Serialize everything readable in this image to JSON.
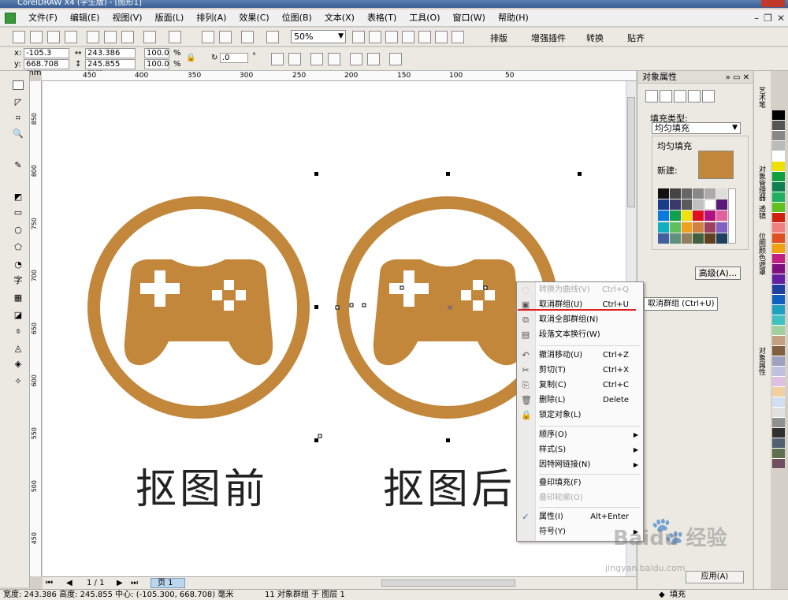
{
  "window": {
    "title": "CorelDRAW X4 (学生版) - [图形1]"
  },
  "menubar": {
    "items": [
      "文件(F)",
      "编辑(E)",
      "视图(V)",
      "版面(L)",
      "排列(A)",
      "效果(C)",
      "位图(B)",
      "文本(X)",
      "表格(T)",
      "工具(O)",
      "窗口(W)",
      "帮助(H)"
    ]
  },
  "toolbar": {
    "zoom": "50%",
    "buttons": [
      "排版",
      "增强插件",
      "转换",
      "贴齐"
    ]
  },
  "property_bar": {
    "x": "-105.3 mm",
    "y": "668.708 mm",
    "width": "243.386 mm",
    "height": "245.855 mm",
    "scale_x": "100.0",
    "scale_y": "100.0",
    "percent": "%",
    "rotation": ".0",
    "degree": "°"
  },
  "ruler": {
    "h_labels": [
      "450",
      "400",
      "350",
      "300",
      "250",
      "200",
      "150",
      "100",
      "50"
    ],
    "v_labels": [
      "850",
      "800",
      "750",
      "700",
      "650",
      "600",
      "550",
      "500",
      "450"
    ]
  },
  "canvas": {
    "fill_color": "#c2873a",
    "caption_left": "抠图前",
    "caption_right": "抠图后"
  },
  "context_menu": {
    "items": [
      {
        "label": "转换为曲线(V)",
        "shortcut": "Ctrl+Q",
        "disabled": true
      },
      {
        "label": "取消群组(U)",
        "shortcut": "Ctrl+U",
        "disabled": false
      },
      {
        "label": "取消全部群组(N)",
        "shortcut": "",
        "disabled": false
      },
      {
        "label": "段落文本换行(W)",
        "shortcut": "",
        "disabled": false
      },
      {
        "label": "撤消移动(U)",
        "shortcut": "Ctrl+Z",
        "disabled": false
      },
      {
        "label": "剪切(T)",
        "shortcut": "Ctrl+X",
        "disabled": false
      },
      {
        "label": "复制(C)",
        "shortcut": "Ctrl+C",
        "disabled": false
      },
      {
        "label": "删除(L)",
        "shortcut": "Delete",
        "disabled": false
      },
      {
        "label": "锁定对象(L)",
        "shortcut": "",
        "disabled": false
      },
      {
        "label": "顺序(O)",
        "shortcut": "",
        "disabled": false
      },
      {
        "label": "样式(S)",
        "shortcut": "",
        "disabled": false
      },
      {
        "label": "因特网链接(N)",
        "shortcut": "",
        "disabled": false
      },
      {
        "label": "叠印填充(F)",
        "shortcut": "",
        "disabled": false
      },
      {
        "label": "叠印轮廓(O)",
        "shortcut": "",
        "disabled": true
      },
      {
        "label": "属性(I)",
        "shortcut": "Alt+Enter",
        "disabled": false
      },
      {
        "label": "符号(Y)",
        "shortcut": "",
        "disabled": false
      }
    ],
    "tooltip": "取消群组 (Ctrl+U)"
  },
  "docker": {
    "title": "对象属性",
    "fill_type_label": "填充类型:",
    "fill_type_value": "均匀填充",
    "group_title": "均匀填充",
    "new_label": "新建:",
    "advanced_button": "高级(A)...",
    "side_tabs": [
      "艺术笔",
      "对象管理器",
      "透镜",
      "位图颜色遮罩",
      "对象属性"
    ]
  },
  "page_nav": {
    "page_count": "1 / 1",
    "page_tab": "页 1"
  },
  "status": {
    "text": "宽度: 243.386  高度: 245.855  中心: (-105.300, 668.708)  毫米",
    "selection": "11 对象群组 于 图层 1"
  },
  "bottom_right": {
    "fill_label": "填充",
    "button": "应用(A)"
  },
  "watermark": {
    "brand": "Baidu 经验",
    "url": "jingyan.baidu.com"
  }
}
